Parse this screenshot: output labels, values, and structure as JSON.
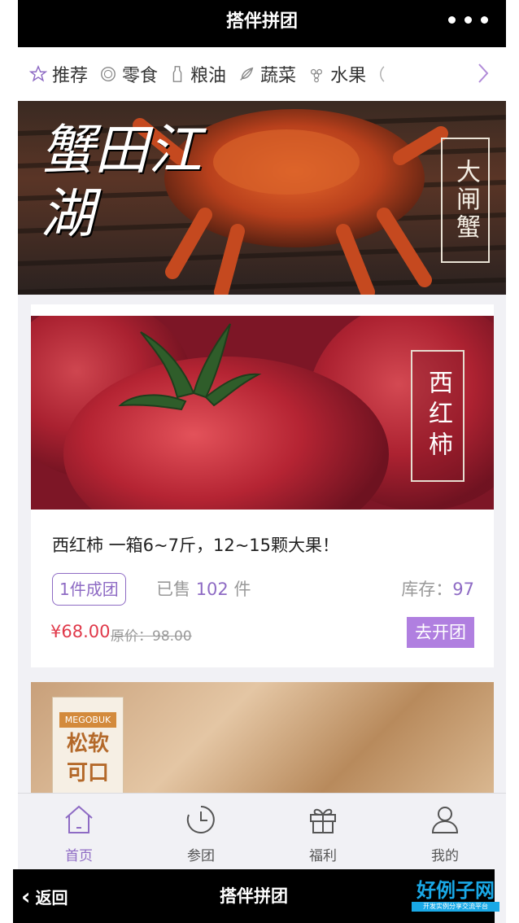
{
  "header": {
    "title": "搭伴拼团",
    "more_icon": "more-dots-icon"
  },
  "categories": [
    {
      "label": "推荐",
      "icon": "star-icon"
    },
    {
      "label": "零食",
      "icon": "cookie-icon"
    },
    {
      "label": "粮油",
      "icon": "bottle-icon"
    },
    {
      "label": "蔬菜",
      "icon": "leaf-icon"
    },
    {
      "label": "水果",
      "icon": "grape-icon"
    }
  ],
  "banner": {
    "calligraphy": "蟹田江湖",
    "tag": "大闸蟹"
  },
  "product": {
    "image_tag": "西红柿",
    "title": "西红柿 一箱6~7斤，12~15颗大果！",
    "group_badge": "1件成团",
    "sold_prefix": "已售",
    "sold_count": "102",
    "sold_suffix": "件",
    "stock_label": "库存：",
    "stock_count": "97",
    "price": "¥68.00",
    "original_price": "原价：98.00",
    "action": "去开团"
  },
  "product2": {
    "brand_en": "MEGOBUK",
    "label_line1": "松软",
    "label_line2": "可口"
  },
  "tabs": [
    {
      "label": "首页",
      "icon": "home-icon",
      "active": true
    },
    {
      "label": "参团",
      "icon": "clock-icon",
      "active": false
    },
    {
      "label": "福利",
      "icon": "gift-icon",
      "active": false
    },
    {
      "label": "我的",
      "icon": "user-icon",
      "active": false
    }
  ],
  "footer": {
    "back_label": "返回",
    "title": "搭伴拼团"
  },
  "watermark_logo": {
    "text": "好例子网",
    "subtext": "开发实例分享交流平台"
  },
  "colors": {
    "accent": "#8e6bc4",
    "button": "#b07fe0",
    "price": "#e0394a",
    "bar": "#000000"
  }
}
